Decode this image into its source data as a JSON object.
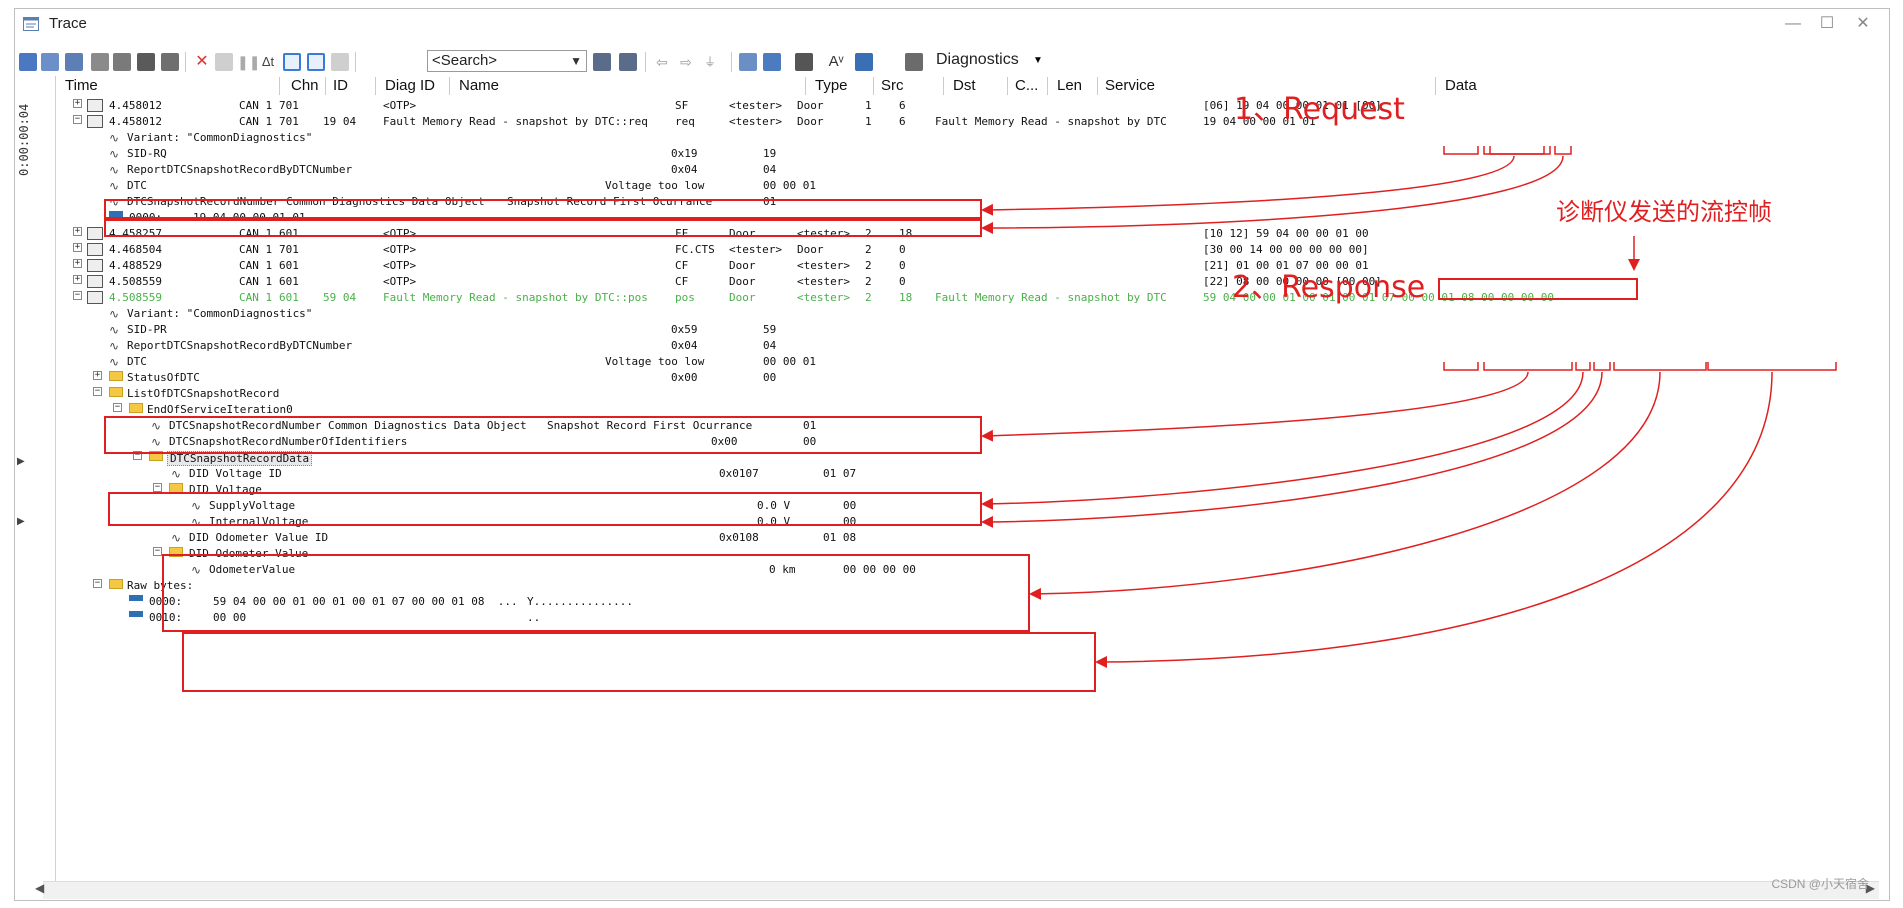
{
  "window": {
    "title": "Trace"
  },
  "toolbar": {
    "search_placeholder": "<Search>",
    "diagnostics_label": "Diagnostics"
  },
  "sidebar": {
    "time_label": "0:00:00:04"
  },
  "columns": [
    "Time",
    "Chn",
    "ID",
    "Diag ID",
    "Name",
    "Type",
    "Src",
    "Dst",
    "C...",
    "Len",
    "Service",
    "Data"
  ],
  "rows": [
    {
      "time": "4.458012",
      "chn": "CAN 1",
      "id": "701",
      "diag": "",
      "name": "<OTP>",
      "type": "SF",
      "src": "<tester>",
      "dst": "Door",
      "c": "1",
      "len": "6",
      "service": "",
      "data": "[06] 19 04 00 00 01 01 [00]"
    },
    {
      "time": "4.458012",
      "chn": "CAN 1",
      "id": "701",
      "diag": "19 04",
      "name": "Fault Memory Read - snapshot by DTC::req",
      "type": "req",
      "src": "<tester>",
      "dst": "Door",
      "c": "1",
      "len": "6",
      "service": "Fault Memory Read - snapshot by DTC",
      "data": "19 04 00 00 01 01"
    },
    {
      "label": "Variant: \"CommonDiagnostics\""
    },
    {
      "label": "SID-RQ",
      "type": "0x19",
      "val": "19"
    },
    {
      "label": "ReportDTCSnapshotRecordByDTCNumber",
      "type": "0x04",
      "val": "04"
    },
    {
      "label": "DTC",
      "phys": "Voltage too low",
      "val": "00 00 01"
    },
    {
      "label": "DTCSnapshotRecordNumber Common Diagnostics Data Object",
      "phys": "Snapshot Record First Ocurrance",
      "val": "01"
    },
    {
      "label": "0000:",
      "hex": "19 04 00 00 01 01",
      "ascii": "......"
    },
    {
      "time": "4.458257",
      "chn": "CAN 1",
      "id": "601",
      "diag": "",
      "name": "<OTP>",
      "type": "FF",
      "src": "Door",
      "dst": "<tester>",
      "c": "2",
      "len": "18",
      "service": "",
      "data": "[10 12] 59 04 00 00 01 00"
    },
    {
      "time": "4.468504",
      "chn": "CAN 1",
      "id": "701",
      "diag": "",
      "name": "<OTP>",
      "type": "FC.CTS",
      "src": "<tester>",
      "dst": "Door",
      "c": "2",
      "len": "0",
      "service": "",
      "data": "[30 00 14 00 00 00 00 00]"
    },
    {
      "time": "4.488529",
      "chn": "CAN 1",
      "id": "601",
      "diag": "",
      "name": "<OTP>",
      "type": "CF",
      "src": "Door",
      "dst": "<tester>",
      "c": "2",
      "len": "0",
      "service": "",
      "data": "[21] 01 00 01 07 00 00 01"
    },
    {
      "time": "4.508559",
      "chn": "CAN 1",
      "id": "601",
      "diag": "",
      "name": "<OTP>",
      "type": "CF",
      "src": "Door",
      "dst": "<tester>",
      "c": "2",
      "len": "0",
      "service": "",
      "data": "[22] 08 00 00 00 00 [00 00]"
    },
    {
      "time": "4.508559",
      "chn": "CAN 1",
      "id": "601",
      "diag": "59 04",
      "name": "Fault Memory Read - snapshot by DTC::pos",
      "type": "pos",
      "src": "Door",
      "dst": "<tester>",
      "c": "2",
      "len": "18",
      "service": "Fault Memory Read - snapshot by DTC",
      "data": "59 04 00 00 01 00 01 00 01 07 00 00 01 08 00 00 00 00"
    },
    {
      "label": "Variant: \"CommonDiagnostics\""
    },
    {
      "label": "SID-PR",
      "type": "0x59",
      "val": "59"
    },
    {
      "label": "ReportDTCSnapshotRecordByDTCNumber",
      "type": "0x04",
      "val": "04"
    },
    {
      "label": "DTC",
      "phys": "Voltage too low",
      "val": "00 00 01"
    },
    {
      "label": "StatusOfDTC",
      "type": "0x00",
      "val": "00"
    },
    {
      "label": "ListOfDTCSnapshotRecord"
    },
    {
      "label": "EndOfServiceIteration0"
    },
    {
      "label": "DTCSnapshotRecordNumber Common Diagnostics Data Object",
      "phys": "Snapshot Record First Ocurrance",
      "val": "01"
    },
    {
      "label": "DTCSnapshotRecordNumberOfIdentifiers",
      "type": "0x00",
      "val": "00"
    },
    {
      "label": "DTCSnapshotRecordData"
    },
    {
      "label": "DID Voltage ID",
      "type": "0x0107",
      "val": "01 07"
    },
    {
      "label": "DID Voltage"
    },
    {
      "label": "SupplyVoltage",
      "phys": "0.0 V",
      "val": "00"
    },
    {
      "label": "InternalVoltage",
      "phys": "0.0 V",
      "val": "00"
    },
    {
      "label": "DID Odometer Value ID",
      "type": "0x0108",
      "val": "01 08"
    },
    {
      "label": "DID Odometer Value"
    },
    {
      "label": "OdometerValue",
      "phys": "0 km",
      "val": "00 00 00 00"
    },
    {
      "label": "Raw bytes:"
    },
    {
      "label": "0000:",
      "hex": "59 04 00 00 01 00 01 00 01 07 00 00 01 08  ...",
      "ascii": "Y..............."
    },
    {
      "label": "0010:",
      "hex": "00 00",
      "ascii": ".."
    }
  ],
  "annotations": {
    "request": "1、Request",
    "response": "2、Response",
    "flow_control": "诊断仪发送的流控帧"
  },
  "watermark": "CSDN @小天宿舍",
  "colors": {
    "annotation_red": "#e02020",
    "pos_green": "#4ab04a"
  }
}
